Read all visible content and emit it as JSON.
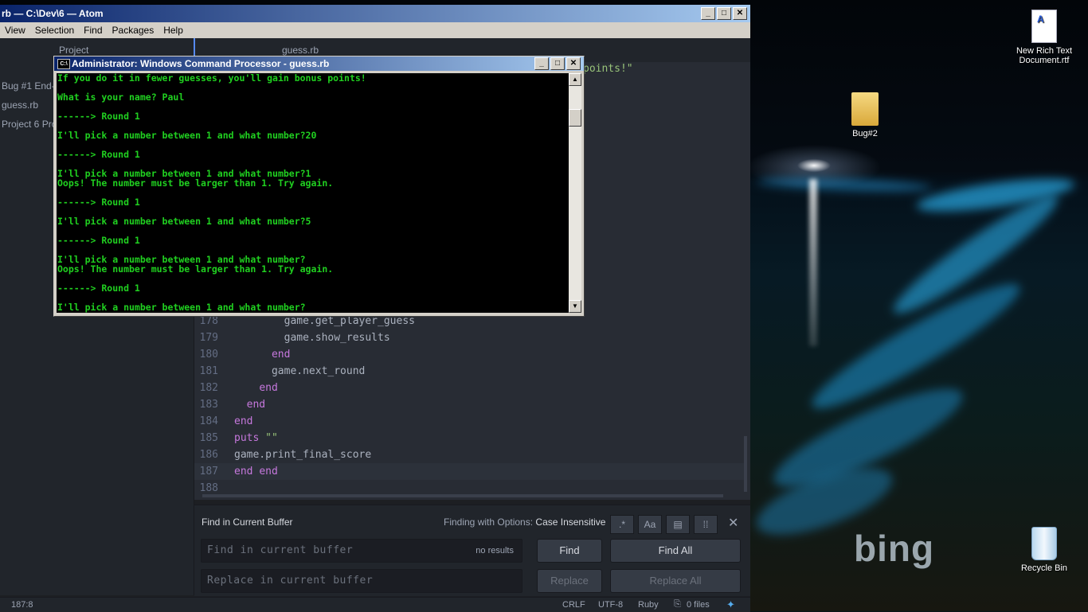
{
  "desktop": {
    "icons": [
      {
        "label": "New Rich Text Document.rtf",
        "icon": "rtf-document-icon"
      },
      {
        "label": "Bug#2",
        "icon": "folder-icon"
      },
      {
        "label": "Recycle Bin",
        "icon": "recycle-bin-icon"
      }
    ],
    "wallpaper_brand": "bing"
  },
  "atom": {
    "title": "rb — C:\\Dev\\6 — Atom",
    "menu": [
      "View",
      "Selection",
      "Find",
      "Packages",
      "Help"
    ],
    "tabs": {
      "project": "Project",
      "file": "guess.rb"
    },
    "sidebar": [
      "Bug #1 End-",
      "guess.rb",
      "Project 6 Pro"
    ],
    "code_fragment": "points!\"",
    "code_lines": [
      {
        "num": "178",
        "text": "        game.get_player_guess"
      },
      {
        "num": "179",
        "text": "        game.show_results"
      },
      {
        "num": "180",
        "text": "      end"
      },
      {
        "num": "181",
        "text": "      game.next_round"
      },
      {
        "num": "182",
        "text": "    end"
      },
      {
        "num": "183",
        "text": "  end"
      },
      {
        "num": "184",
        "text": "end"
      },
      {
        "num": "185",
        "text": "puts \"\""
      },
      {
        "num": "186",
        "text": "game.print_final_score"
      },
      {
        "num": "187",
        "text": "end end"
      },
      {
        "num": "188",
        "text": ""
      }
    ],
    "find": {
      "header": "Find in Current Buffer",
      "options_label": "Finding with Options:",
      "options_value": "Case Insensitive",
      "opt_regex": ".*",
      "opt_case": "Aa",
      "find_placeholder": "Find in current buffer",
      "results": "no results",
      "replace_placeholder": "Replace in current buffer",
      "find_btn": "Find",
      "find_all_btn": "Find All",
      "replace_btn": "Replace",
      "replace_all_btn": "Replace All"
    },
    "status": {
      "cursor": "187:8",
      "line_ending": "CRLF",
      "encoding": "UTF-8",
      "grammar": "Ruby",
      "files": "0 files"
    }
  },
  "cmd": {
    "title": "Administrator: Windows Command Processor - guess.rb",
    "lines": [
      "If you do it in fewer guesses, you'll gain bonus points!",
      "",
      "What is your name? Paul",
      "",
      "------> Round 1",
      "",
      "I'll pick a number between 1 and what number?20",
      "",
      "------> Round 1",
      "",
      "I'll pick a number between 1 and what number?1",
      "Oops! The number must be larger than 1. Try again.",
      "",
      "------> Round 1",
      "",
      "I'll pick a number between 1 and what number?5",
      "",
      "------> Round 1",
      "",
      "I'll pick a number between 1 and what number?",
      "Oops! The number must be larger than 1. Try again.",
      "",
      "------> Round 1",
      "",
      "I'll pick a number between 1 and what number?"
    ]
  }
}
